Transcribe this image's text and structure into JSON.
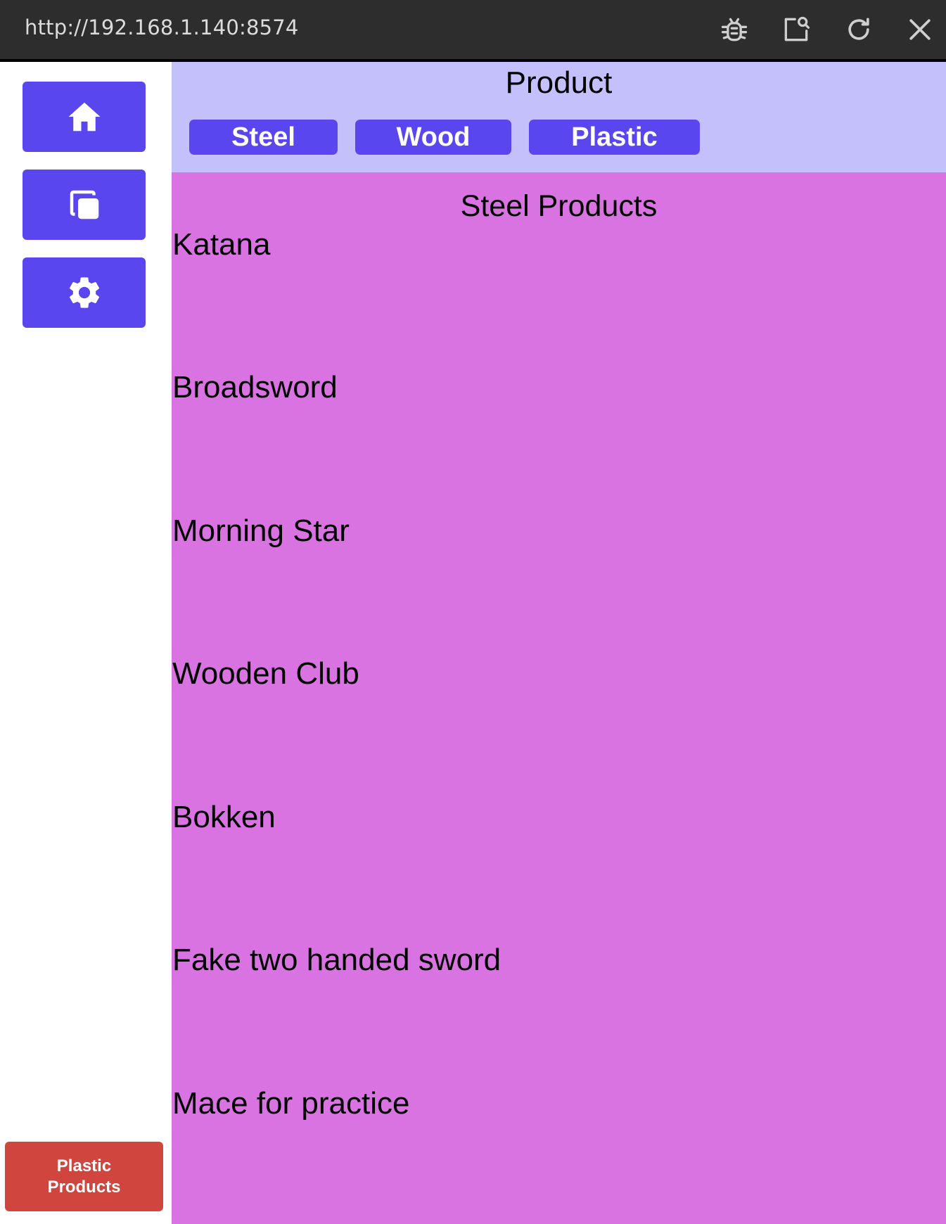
{
  "window": {
    "url": "http://192.168.1.140:8574",
    "icons": [
      "bug-icon",
      "inspect-icon",
      "refresh-icon",
      "close-icon"
    ]
  },
  "sidebar": {
    "buttons": [
      {
        "icon": "home-icon"
      },
      {
        "icon": "copy-icon"
      },
      {
        "icon": "settings-icon"
      }
    ],
    "toast": {
      "label": "Plastic Products"
    }
  },
  "header": {
    "title": "Product",
    "tabs": [
      {
        "label": "Steel"
      },
      {
        "label": "Wood"
      },
      {
        "label": "Plastic"
      }
    ]
  },
  "content": {
    "section_title": "Steel Products",
    "items": [
      "Katana",
      "Broadsword",
      "Morning Star",
      "Wooden Club",
      "Bokken",
      "Fake two handed sword",
      "Mace for practice"
    ]
  },
  "colors": {
    "titlebar": "#2d2d2d",
    "accent": "#5a46ee",
    "header_bg": "#c3c0fb",
    "content_bg": "#da73e2",
    "toast_bg": "#d0453e"
  }
}
